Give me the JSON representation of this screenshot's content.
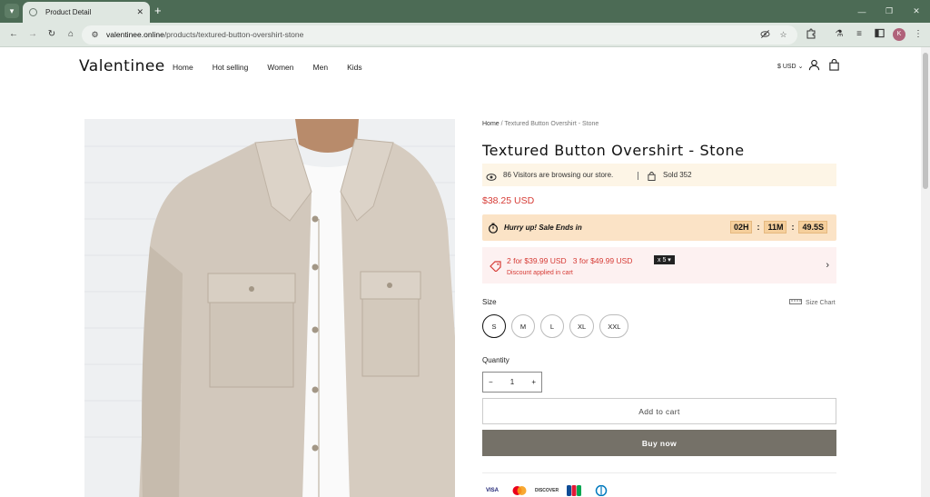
{
  "browser": {
    "tab_title": "Product Detail",
    "url_host": "valentinee.online",
    "url_path": "/products/textured-button-overshirt-stone",
    "profile_initial": "K"
  },
  "header": {
    "logo": "Valentinee",
    "nav": [
      "Home",
      "Hot selling",
      "Women",
      "Men",
      "Kids"
    ],
    "currency": "$ USD"
  },
  "breadcrumb": {
    "home": "Home",
    "current": " / Textured Button Overshirt - Stone"
  },
  "product": {
    "title": "Textured Button Overshirt - Stone",
    "visitors_text": "86 Visitors are browsing our store.",
    "sold_text": "Sold 352",
    "price": "$38.25 USD",
    "sale_text": "Hurry up! Sale Ends in",
    "timer": {
      "hours": "02H",
      "minutes": "11M",
      "seconds": "49.5S"
    },
    "discount_main": "2 for $39.99 USD   3 for $49.99 USD",
    "discount_badge": "x 5",
    "discount_sub": "Discount applied in cart",
    "size_label": "Size",
    "size_chart": "Size Chart",
    "sizes": [
      "S",
      "M",
      "L",
      "XL",
      "XXL"
    ],
    "selected_size": "S",
    "quantity_label": "Quantity",
    "quantity": "1",
    "add_to_cart": "Add to cart",
    "buy_now": "Buy now"
  },
  "payments": [
    "VISA",
    "Mastercard",
    "DISCOVER",
    "JCB",
    "Diners Club"
  ],
  "colors": {
    "chrome": "#4c6b55",
    "price_red": "#d63b35",
    "sale_bar": "#fbe3c6",
    "buy_now": "#757168"
  }
}
